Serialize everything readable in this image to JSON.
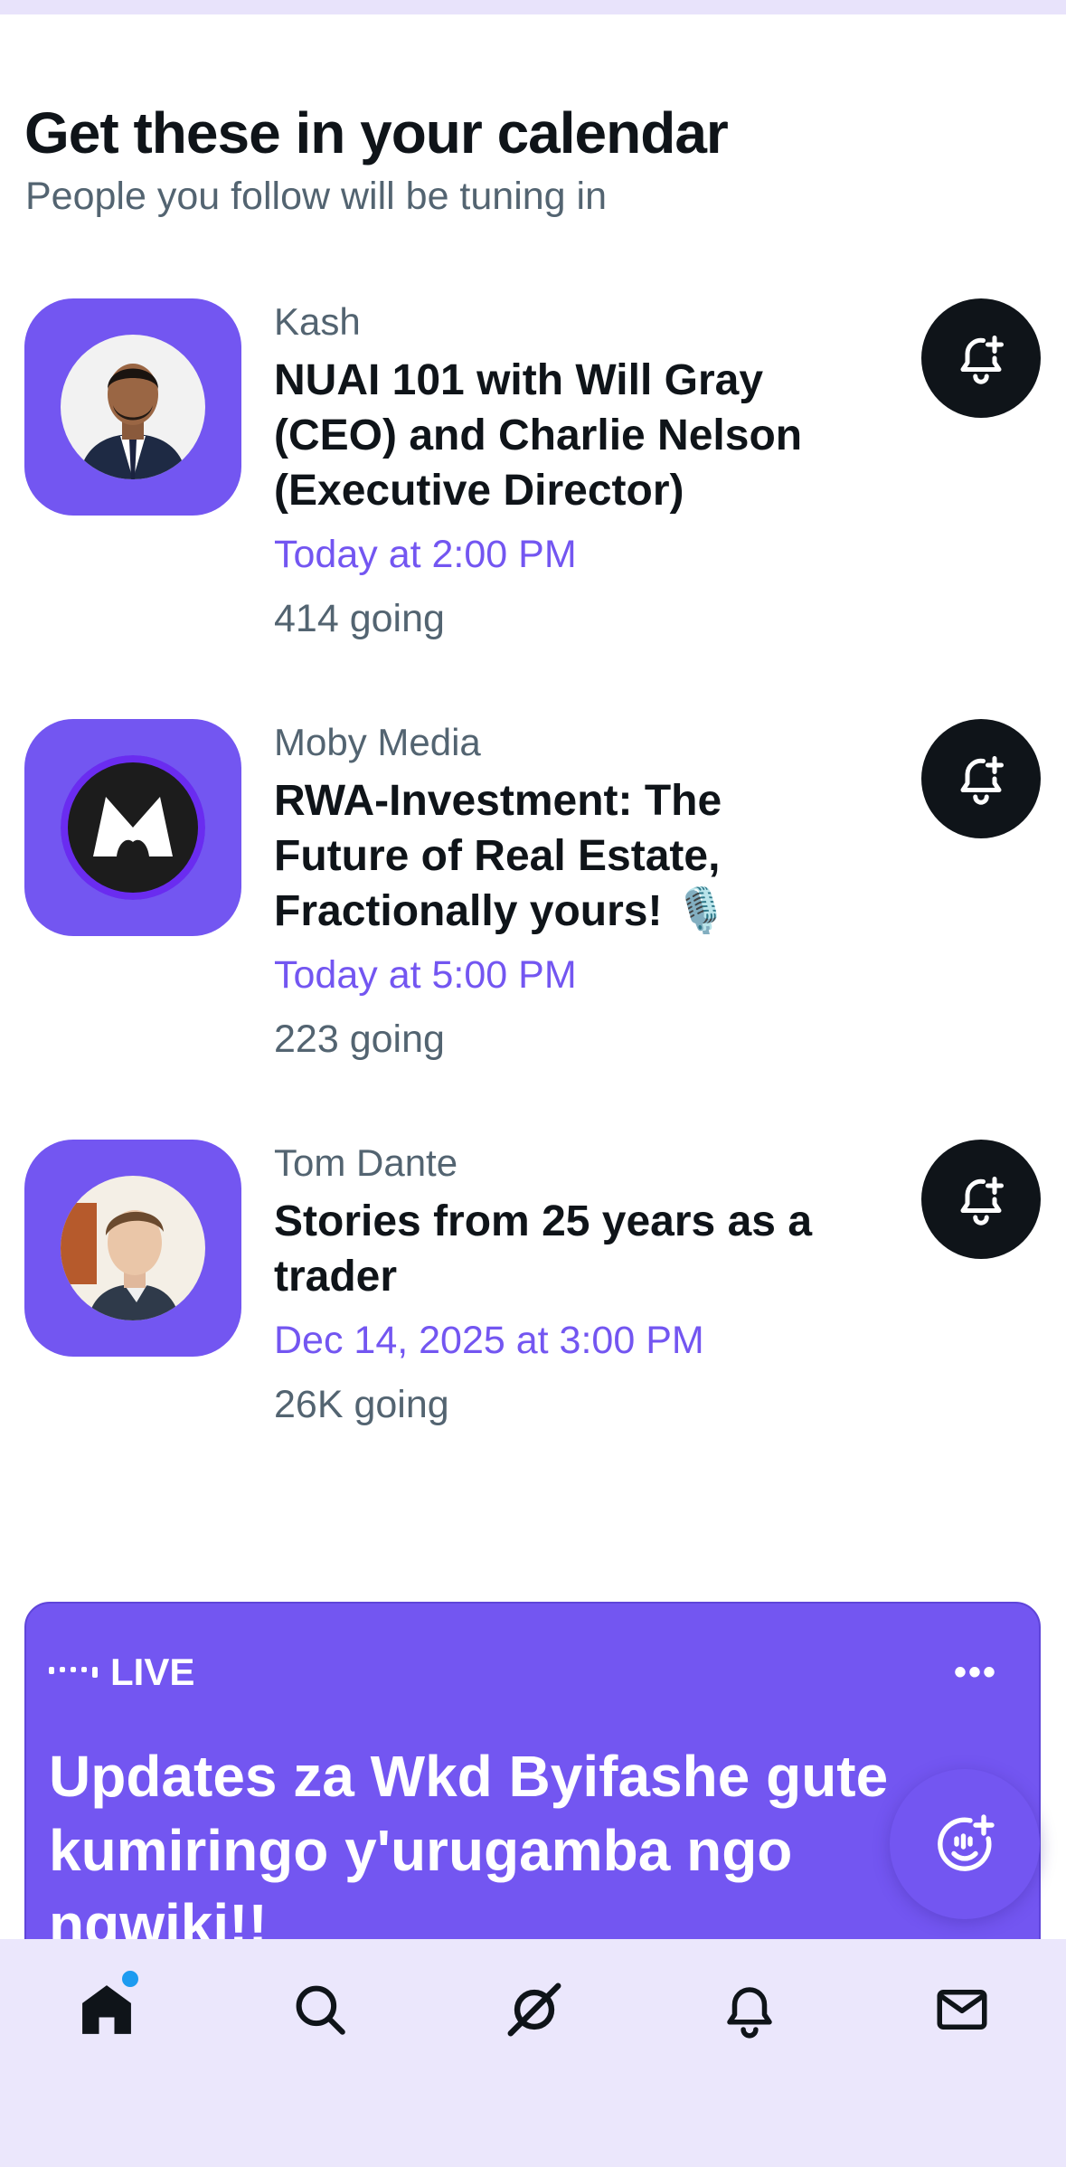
{
  "section": {
    "title": "Get these in your calendar",
    "subtitle": "People you follow will be tuning in"
  },
  "events": [
    {
      "host": "Kash",
      "title": "NUAI 101 with Will Gray (CEO) and Charlie Nelson (Executive Director)",
      "time": "Today at 2:00 PM",
      "going": "414 going",
      "avatar": "man-in-suit-avatar"
    },
    {
      "host": "Moby Media",
      "title": "RWA-Investment: The Future of Real Estate, Fractionally yours! 🎙️",
      "time": "Today at 5:00 PM",
      "going": "223 going",
      "avatar": "moby-m-logo-avatar"
    },
    {
      "host": "Tom Dante",
      "title": "Stories from 25 years as a trader",
      "time": "Dec 14, 2025 at 3:00 PM",
      "going": "26K going",
      "avatar": "young-man-avatar"
    }
  ],
  "live_card": {
    "badge": "LIVE",
    "more": "•••",
    "title": "Updates za Wkd Byifashe gute kumiringo y'urugamba ngo ngwiki!!"
  },
  "bottom_nav": [
    "home",
    "search",
    "grok",
    "notifications",
    "messages"
  ],
  "colors": {
    "accent": "#7356f1",
    "text": "#0f1419",
    "secondary": "#536471",
    "nav_bg": "#ebe7fc",
    "dot": "#1d9bf0"
  }
}
